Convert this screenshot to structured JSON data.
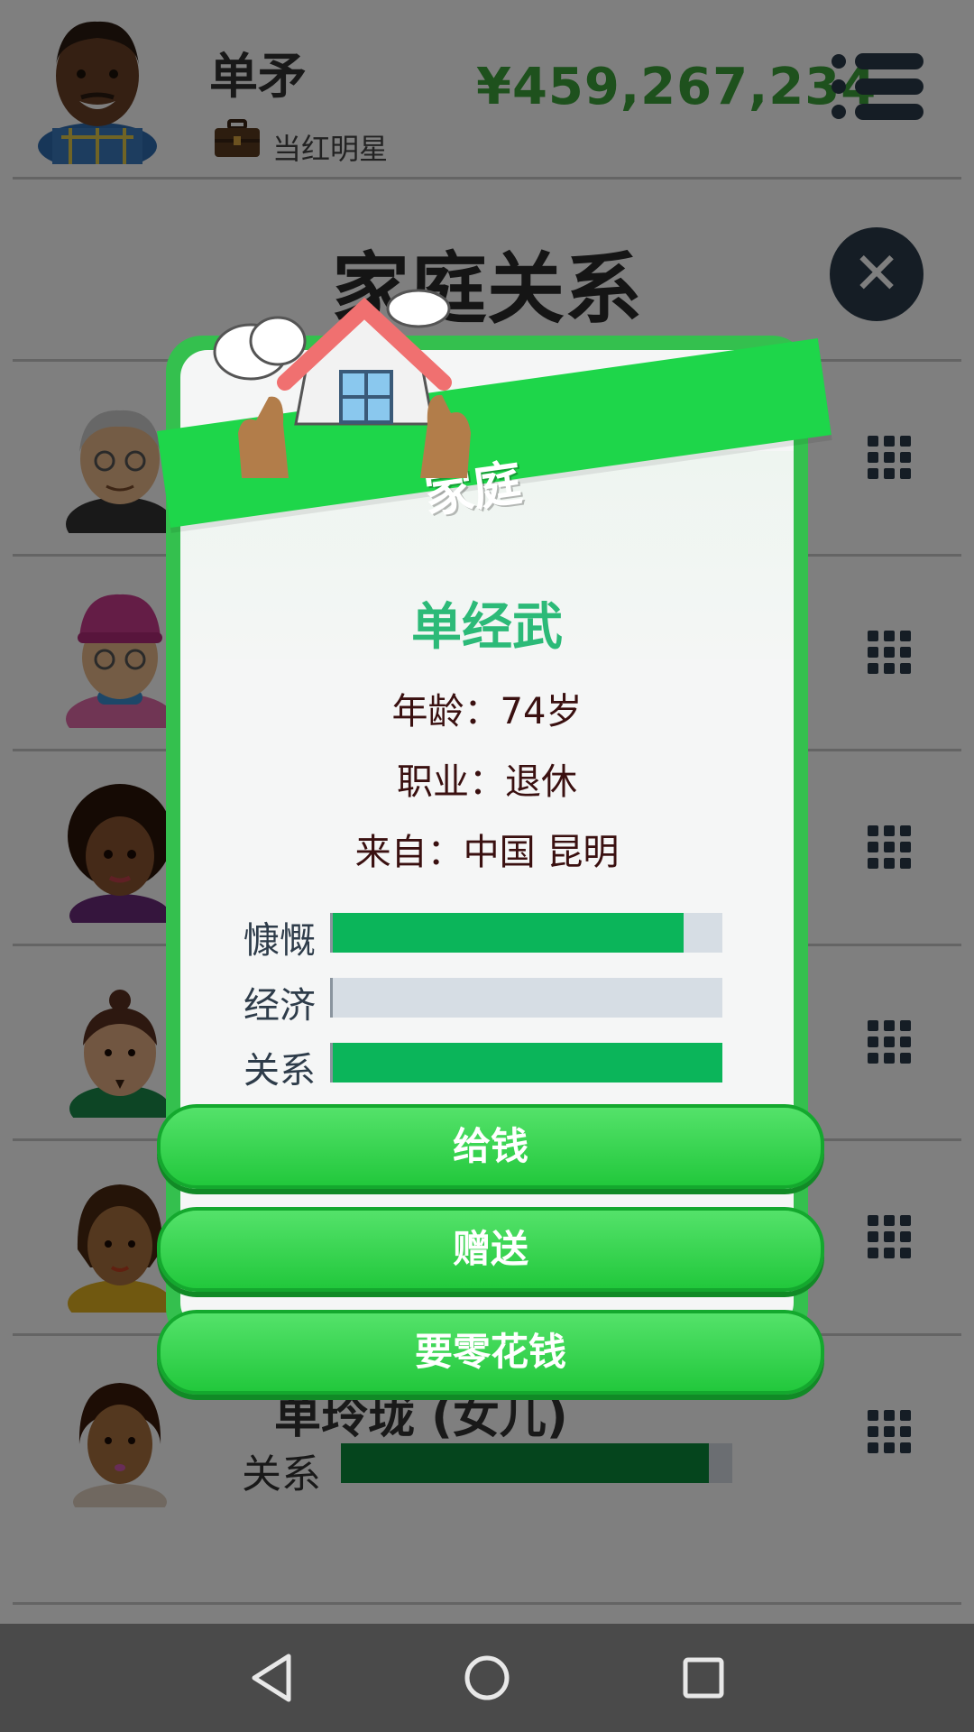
{
  "header": {
    "player_name": "单矛",
    "player_job": "当红明星",
    "money": "¥459,267,234"
  },
  "page": {
    "title": "家庭关系"
  },
  "background_rows": [
    {
      "avatar": "grandpa-avatar"
    },
    {
      "avatar": "grandma-avatar"
    },
    {
      "avatar": "mother-avatar"
    },
    {
      "avatar": "father-avatar"
    },
    {
      "avatar": "sibling-avatar"
    },
    {
      "avatar": "daughter-avatar",
      "title": "单玲珑 (女儿)",
      "rel_label": "关系",
      "rel_value": 0.94
    }
  ],
  "modal": {
    "banner": "家庭",
    "name": "单经武",
    "age_line": "年龄：74岁",
    "job_line": "职业：退休",
    "from_line": "来自：中国 昆明",
    "stats": [
      {
        "label": "慷慨",
        "value": 0.9
      },
      {
        "label": "经济",
        "value": 0.0
      },
      {
        "label": "关系",
        "value": 1.0
      }
    ],
    "buttons": [
      "给钱",
      "赠送",
      "要零花钱"
    ]
  },
  "colors": {
    "money": "#3da33a",
    "accent_green": "#1ed64a",
    "name_green": "#2cba78",
    "bar_fill": "#0bb55a",
    "bar_bg": "#d6dde4",
    "dark": "#2b3a4a"
  },
  "navbar": {
    "icons": [
      "back-icon",
      "home-icon",
      "recents-icon"
    ]
  }
}
